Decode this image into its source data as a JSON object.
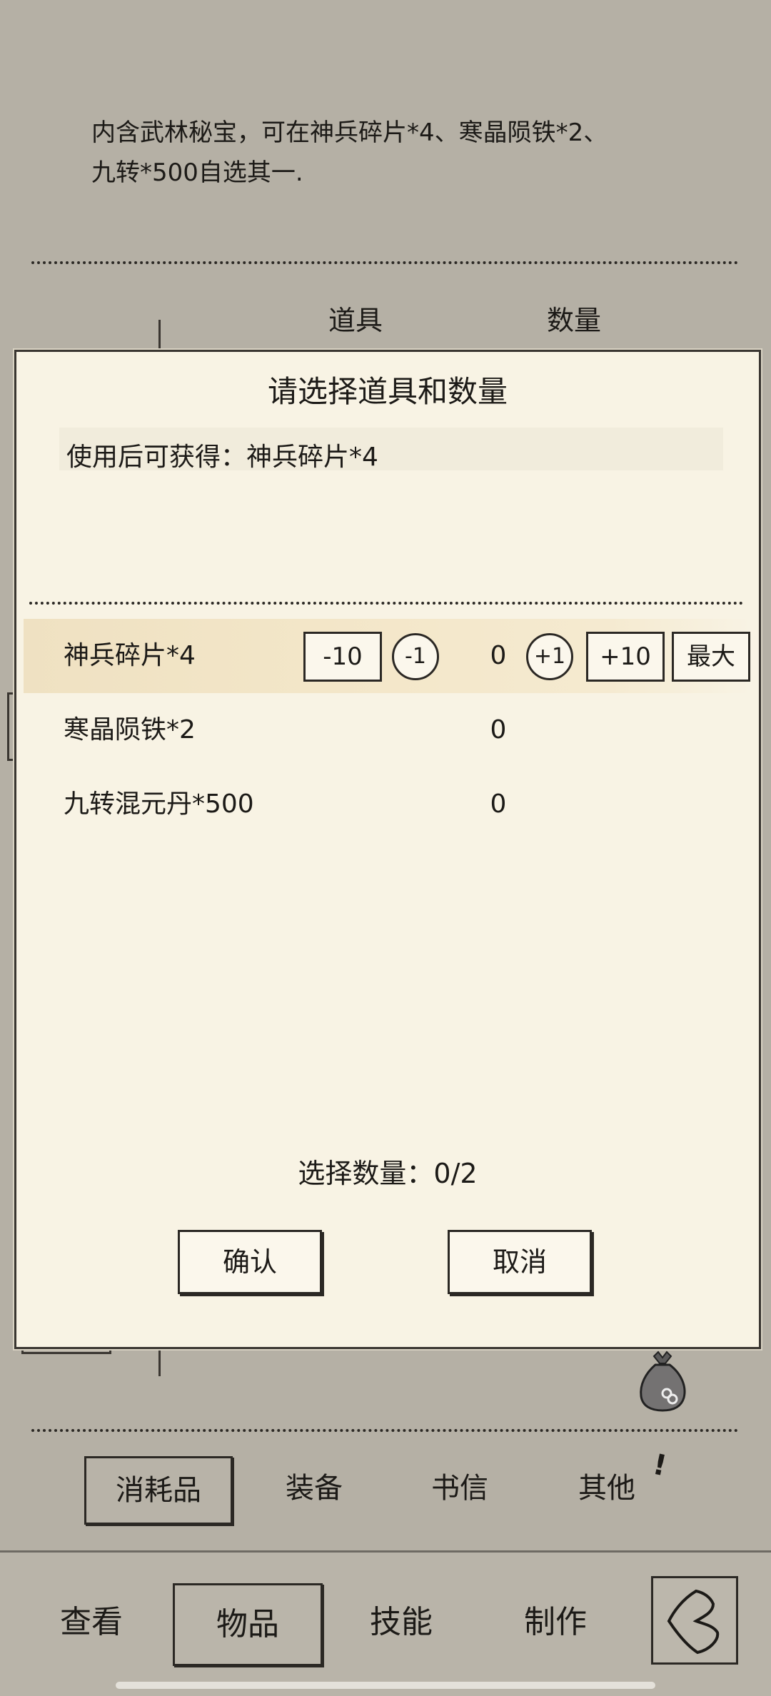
{
  "background": {
    "description_line1": "内含武林秘宝，可在神兵碎片*4、寒晶陨铁*2、",
    "description_line2": "九转*500自选其一.",
    "col_item": "道具",
    "col_qty": "数量"
  },
  "dialog": {
    "title": "请选择道具和数量",
    "gain_text": "使用后可获得：神兵碎片*4",
    "items": [
      {
        "name": "神兵碎片*4",
        "value": "0"
      },
      {
        "name": "寒晶陨铁*2",
        "value": "0"
      },
      {
        "name": "九转混元丹*500",
        "value": "0"
      }
    ],
    "controls": {
      "minus10": "-10",
      "minus1": "-1",
      "plus1": "+1",
      "plus10": "+10",
      "max": "最大"
    },
    "selection_count": "选择数量：0/2",
    "confirm": "确认",
    "cancel": "取消"
  },
  "categories": [
    {
      "label": "消耗品",
      "active": true
    },
    {
      "label": "装备",
      "active": false
    },
    {
      "label": "书信",
      "active": false
    },
    {
      "label": "其他",
      "active": false
    }
  ],
  "nav": [
    {
      "label": "查看",
      "active": false
    },
    {
      "label": "物品",
      "active": true
    },
    {
      "label": "技能",
      "active": false
    },
    {
      "label": "制作",
      "active": false
    }
  ],
  "icons": {
    "bag": "money-bag-icon",
    "back": "back-arrow-icon",
    "exclaim": "!"
  },
  "colors": {
    "background": "#b5b0a5",
    "dialog": "#f8f3e4",
    "highlight": "#efe1c2",
    "ink": "#1c1a17"
  }
}
